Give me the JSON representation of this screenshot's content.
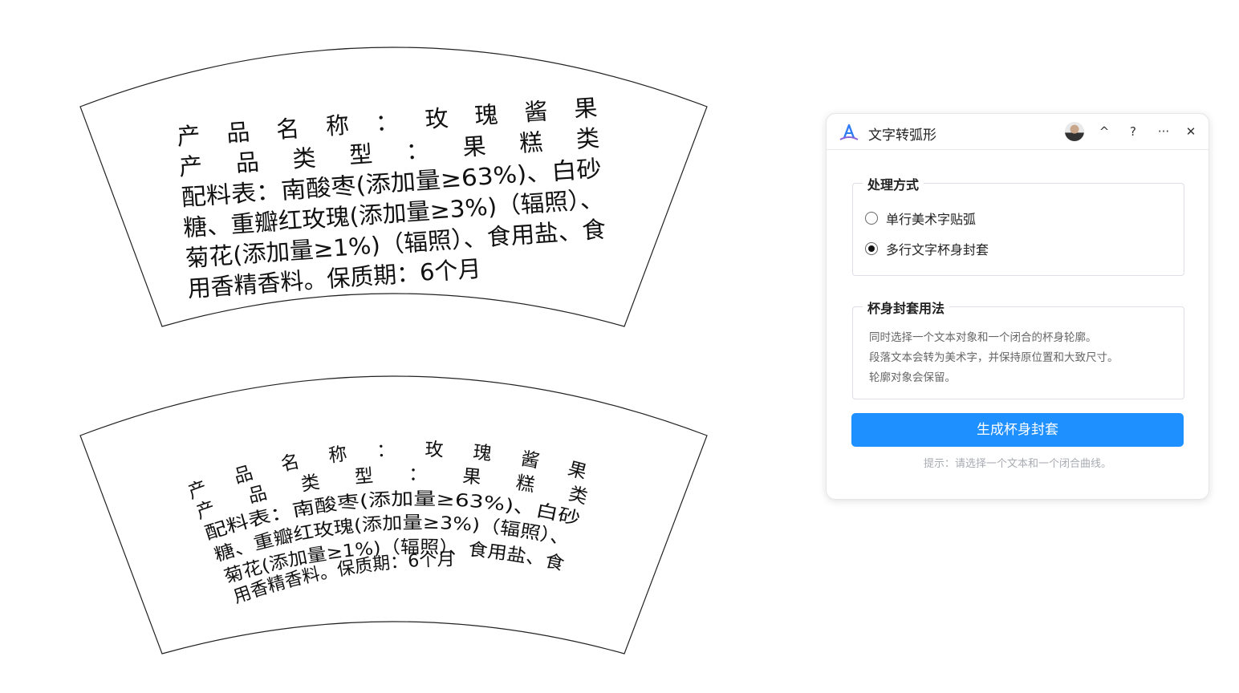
{
  "cup_text": {
    "lines": [
      "产  品  名  称  ：  玫  瑰  酱  果",
      "产    品    类    型    ：    果    糕    类",
      "配料表：南酸枣(添加量≥63%)、白砂",
      "糖、重瓣红玫瑰(添加量≥3%)（辐照）、",
      "菊花(添加量≥1%)（辐照）、食用盐、食",
      "用香精香料。保质期：6个月"
    ]
  },
  "panel": {
    "title": "文字转弧形",
    "header_icons": [
      "caret-up-icon",
      "help-icon",
      "more-icon",
      "close-icon"
    ],
    "caret_label": "^",
    "help_label": "?",
    "more_label": "···",
    "close_label": "✕",
    "mode_group": {
      "legend": "处理方式",
      "options": [
        {
          "label": "单行美术字贴弧",
          "checked": false
        },
        {
          "label": "多行文字杯身封套",
          "checked": true
        }
      ]
    },
    "usage_group": {
      "legend": "杯身封套用法",
      "lines": [
        "同时选择一个文本对象和一个闭合的杯身轮廓。",
        "段落文本会转为美术字，并保持原位置和大致尺寸。",
        "轮廓对象会保留。"
      ]
    },
    "primary_button": "生成杯身封套",
    "hint": "提示：请选择一个文本和一个闭合曲线。",
    "accent_color": "#1e90ff"
  }
}
